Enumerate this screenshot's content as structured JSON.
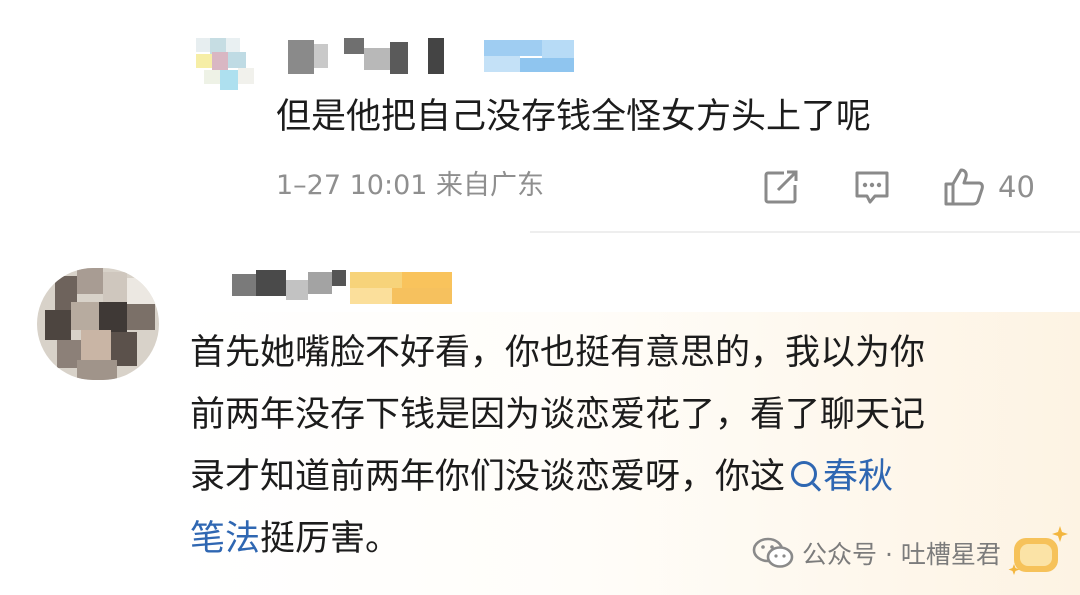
{
  "comment1": {
    "text": "但是他把自己没存钱全怪女方头上了呢",
    "meta": "1–27 10:01 来自广东",
    "like_count": "40",
    "icons": {
      "share": "share-icon",
      "reply": "comment-icon",
      "like": "thumbs-up-icon"
    }
  },
  "comment2": {
    "lines": [
      "首先她嘴脸不好看，你也挺有意思的，我以为你",
      "前两年没存下钱是因为谈恋爱花了，看了聊天记"
    ],
    "line3_text": "录才知道前两年你们没谈恋爱呀，你这",
    "link_part1": "春秋",
    "link_part2": "笔法",
    "line4_rest": "挺厉害。",
    "link_color": "#2f67b2"
  },
  "watermark": {
    "text": "公众号 · 吐槽星君",
    "icon": "wechat-icon"
  },
  "colors": {
    "text": "#1c1c1c",
    "meta": "#8f8f8f",
    "highlight_bg": "#fdf3e3"
  }
}
